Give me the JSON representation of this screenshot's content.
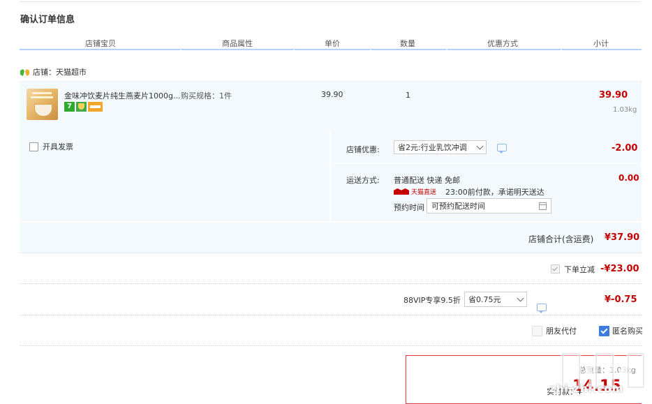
{
  "page": {
    "title": "确认订单信息"
  },
  "table_header": {
    "columns": [
      "店铺宝贝",
      "商品属性",
      "单价",
      "数量",
      "优惠方式",
      "小计"
    ]
  },
  "store": {
    "name": "店铺：天猫超市"
  },
  "item": {
    "name": "金味冲饮麦片纯生燕麦片1000g...",
    "spec": "购买规格：1件",
    "badge_seven": "7",
    "unit_price": "39.90",
    "quantity": "1",
    "subtotal": "39.90",
    "weight": "1.03kg"
  },
  "options": {
    "invoice_label": "开具发票",
    "coupon_label": "店铺优惠:",
    "coupon_selected": "省2元:行业乳饮冲调",
    "coupon_amount": "-2.00",
    "shipping_label": "运送方式:",
    "shipping_value": "普通配送 快递 免邮",
    "shipping_fee": "0.00",
    "tmall_direct": "天猫直送",
    "promise": "23:00前付款，承诺明天送达",
    "reserve_label": "预约时间",
    "reserve_placeholder": "可预约配送时间"
  },
  "store_total": {
    "label": "店铺合计(含运费)",
    "amount": "¥37.90"
  },
  "order_discount": {
    "label": "下单立减",
    "amount": "-¥23.00"
  },
  "vip": {
    "label": "88VIP专享9.5折",
    "selected": "省0.75元",
    "amount": "¥-0.75"
  },
  "checkout_options": {
    "friend_pay": "朋友代付",
    "anonymous": "匿名购买"
  },
  "payment": {
    "weight_label": "总重量：1.03kg",
    "pay_label": "实付款：¥",
    "pay_amount": "14.15"
  },
  "watermark": {
    "text": "zhi.zhi.com"
  },
  "colors": {
    "accent_red": "#c40000",
    "header_border": "#b2d1ff",
    "row_bg": "#f4f9fe",
    "check_blue": "#3d7be0"
  }
}
